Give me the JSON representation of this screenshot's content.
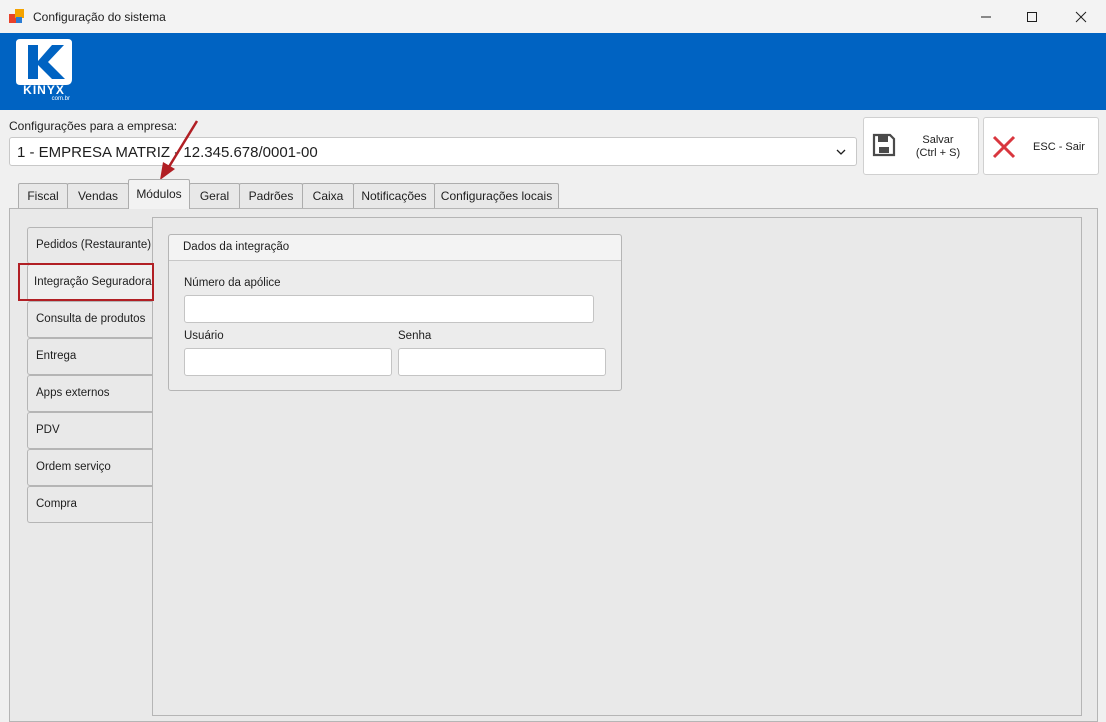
{
  "window": {
    "title": "Configuração do sistema"
  },
  "logo": {
    "text": "KINYX",
    "subtext": "com.br"
  },
  "company": {
    "label": "Configurações para a empresa:",
    "selected": "1 - EMPRESA MATRIZ - 12.345.678/0001-00"
  },
  "toolbar": {
    "save_label_line1": "Salvar",
    "save_label_line2": "(Ctrl + S)",
    "exit_label": "ESC - Sair"
  },
  "tabs": [
    "Fiscal",
    "Vendas",
    "Módulos",
    "Geral",
    "Padrões",
    "Caixa",
    "Notificações",
    "Configurações locais"
  ],
  "active_tab": "Módulos",
  "module_tabs": [
    "Pedidos (Restaurante)",
    "Integração Seguradora",
    "Consulta de produtos",
    "Entrega",
    "Apps externos",
    "PDV",
    "Ordem serviço",
    "Compra"
  ],
  "active_module_tab": "Integração Seguradora",
  "integration": {
    "title": "Dados da integração",
    "policy_label": "Número da apólice",
    "policy_value": "",
    "user_label": "Usuário",
    "user_value": "",
    "password_label": "Senha",
    "password_value": ""
  },
  "colors": {
    "banner": "#0063c2",
    "highlight": "#b11f24",
    "close_x": "#d9363e"
  }
}
